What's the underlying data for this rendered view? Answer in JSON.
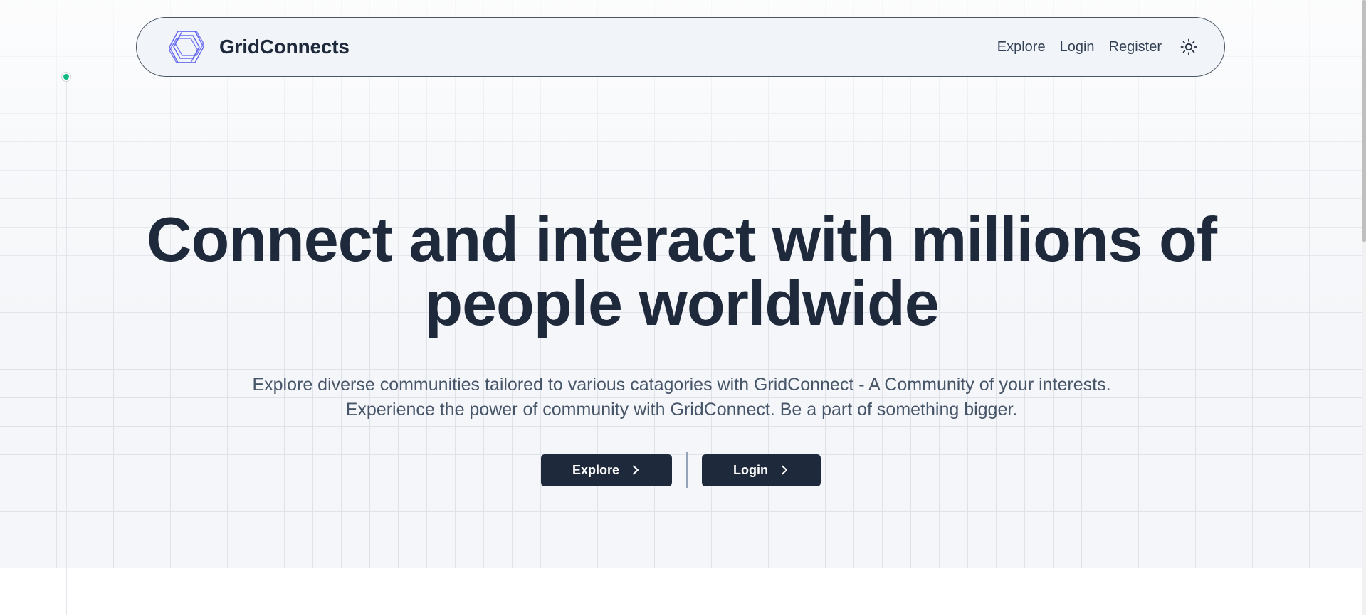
{
  "navbar": {
    "brand_name": "GridConnects",
    "links": [
      {
        "label": "Explore"
      },
      {
        "label": "Login"
      },
      {
        "label": "Register"
      }
    ],
    "theme_toggle_icon": "sun-icon"
  },
  "hero": {
    "title": "Connect and interact with millions of people worldwide",
    "subtitle": "Explore diverse communities tailored to various catagories with GridConnect - A Community of your interests. Experience the power of community with GridConnect. Be a part of something bigger.",
    "buttons": {
      "explore_label": "Explore",
      "login_label": "Login"
    }
  },
  "colors": {
    "text_primary": "#1e293b",
    "button_bg": "#1e293b",
    "logo_stroke": "#6366f1",
    "status_dot": "#10b981",
    "grid_line": "#dfe3e9"
  }
}
